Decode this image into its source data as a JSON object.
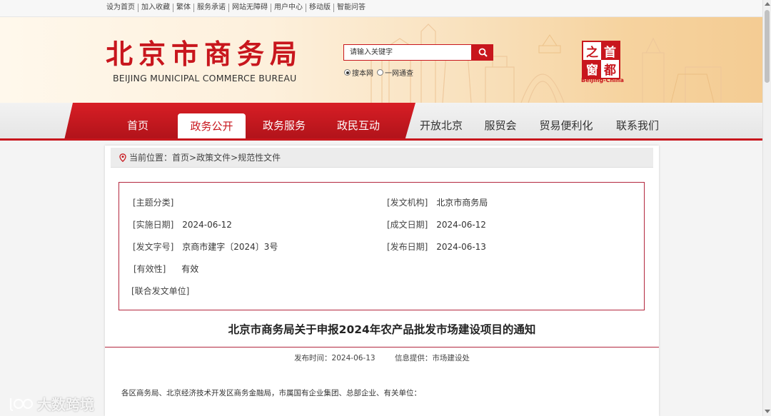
{
  "topbar": {
    "links": [
      "设为首页",
      "加入收藏",
      "繁体",
      "服务承诺",
      "网站无障碍",
      "用户中心",
      "移动版",
      "智能问答"
    ]
  },
  "header": {
    "title_cn": "北京市商务局",
    "title_en": "BEIJING MUNICIPAL COMMERCE BUREAU",
    "search_value": "请输入关键字",
    "search_scope": [
      "搜本网",
      "一网通查"
    ],
    "seal_chars": [
      "之",
      "首",
      "窗",
      "都"
    ],
    "seal_sub": "Beijing-China"
  },
  "nav": {
    "items": [
      "首页",
      "政务公开",
      "政务服务",
      "政民互动",
      "开放北京",
      "服贸会",
      "贸易便利化",
      "联系我们"
    ],
    "active_index": 1
  },
  "breadcrumb": {
    "label": "当前位置：",
    "path": "首页>政策文件>规范性文件"
  },
  "meta": {
    "theme_label": "[主题分类]",
    "theme_value": "",
    "issuer_label": "[发文机构]",
    "issuer_value": "北京市商务局",
    "impl_date_label": "[实施日期]",
    "impl_date_value": "2024-06-12",
    "written_date_label": "[成文日期]",
    "written_date_value": "2024-06-12",
    "doc_no_label": "[发文字号]",
    "doc_no_value": "京商市建字〔2024〕3号",
    "pub_date_label": "[发布日期]",
    "pub_date_value": "2024-06-13",
    "validity_label": "[有效性]",
    "validity_value": "有效",
    "joint_label": "[联合发文单位]",
    "joint_value": ""
  },
  "article": {
    "title": "北京市商务局关于申报2024年农产品批发市场建设项目的通知",
    "publish_time": "发布时间：2024-06-13",
    "source": "信息提供：市场建设处",
    "body_first_line": "各区商务局、北京经济技术开发区商务金融局，市属国有企业集团、总部企业、有关单位："
  },
  "watermark": {
    "text": "大数跨境"
  },
  "colors": {
    "brand_red": "#c8161d",
    "border_red": "#b3273e"
  }
}
